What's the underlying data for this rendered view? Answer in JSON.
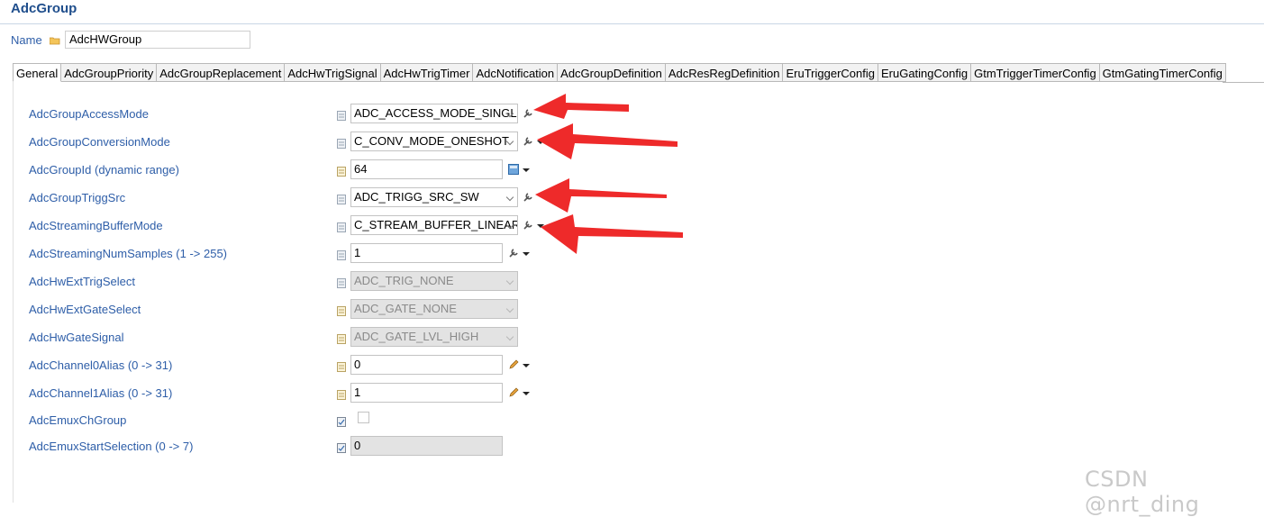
{
  "header": {
    "title": "AdcGroup"
  },
  "name_field": {
    "label": "Name",
    "value": "AdcHWGroup"
  },
  "tabs": [
    {
      "label": "General",
      "active": true
    },
    {
      "label": "AdcGroupPriority"
    },
    {
      "label": "AdcGroupReplacement"
    },
    {
      "label": "AdcHwTrigSignal"
    },
    {
      "label": "AdcHwTrigTimer"
    },
    {
      "label": "AdcNotification"
    },
    {
      "label": "AdcGroupDefinition"
    },
    {
      "label": "AdcResRegDefinition"
    },
    {
      "label": "EruTriggerConfig"
    },
    {
      "label": "EruGatingConfig"
    },
    {
      "label": "GtmTriggerTimerConfig"
    },
    {
      "label": "GtmGatingTimerConfig"
    }
  ],
  "params": [
    {
      "label": "AdcGroupAccessMode",
      "value": "ADC_ACCESS_MODE_SINGLE"
    },
    {
      "label": "AdcGroupConversionMode",
      "value": "C_CONV_MODE_ONESHOT"
    },
    {
      "label": "AdcGroupId (dynamic range)",
      "value": "64"
    },
    {
      "label": "AdcGroupTriggSrc",
      "value": "ADC_TRIGG_SRC_SW"
    },
    {
      "label": "AdcStreamingBufferMode",
      "value": "C_STREAM_BUFFER_LINEAR"
    },
    {
      "label": "AdcStreamingNumSamples (1 -> 255)",
      "value": "1"
    },
    {
      "label": "AdcHwExtTrigSelect",
      "value": "ADC_TRIG_NONE"
    },
    {
      "label": "AdcHwExtGateSelect",
      "value": "ADC_GATE_NONE"
    },
    {
      "label": "AdcHwGateSignal",
      "value": "ADC_GATE_LVL_HIGH"
    },
    {
      "label": "AdcChannel0Alias (0 -> 31)",
      "value": "0"
    },
    {
      "label": "AdcChannel1Alias (0 -> 31)",
      "value": "1"
    },
    {
      "label": "AdcEmuxChGroup"
    },
    {
      "label": "AdcEmuxStartSelection (0 -> 7)",
      "value": "0"
    }
  ],
  "icons": {
    "name": "folder-icon",
    "param": "parameter-icon",
    "select_action": "wrench-icon",
    "id_action": "calculator-icon",
    "alias_action": "pencil-icon",
    "dropdown": "chevron-down-icon",
    "annotation": "red-arrow-icon"
  },
  "colors": {
    "title": "#1f4e8c",
    "label": "#2e5ea8",
    "annotation_arrow": "#ee2a2a",
    "disabled_field": "#e3e3e3"
  },
  "watermark": "CSDN @nrt_ding"
}
